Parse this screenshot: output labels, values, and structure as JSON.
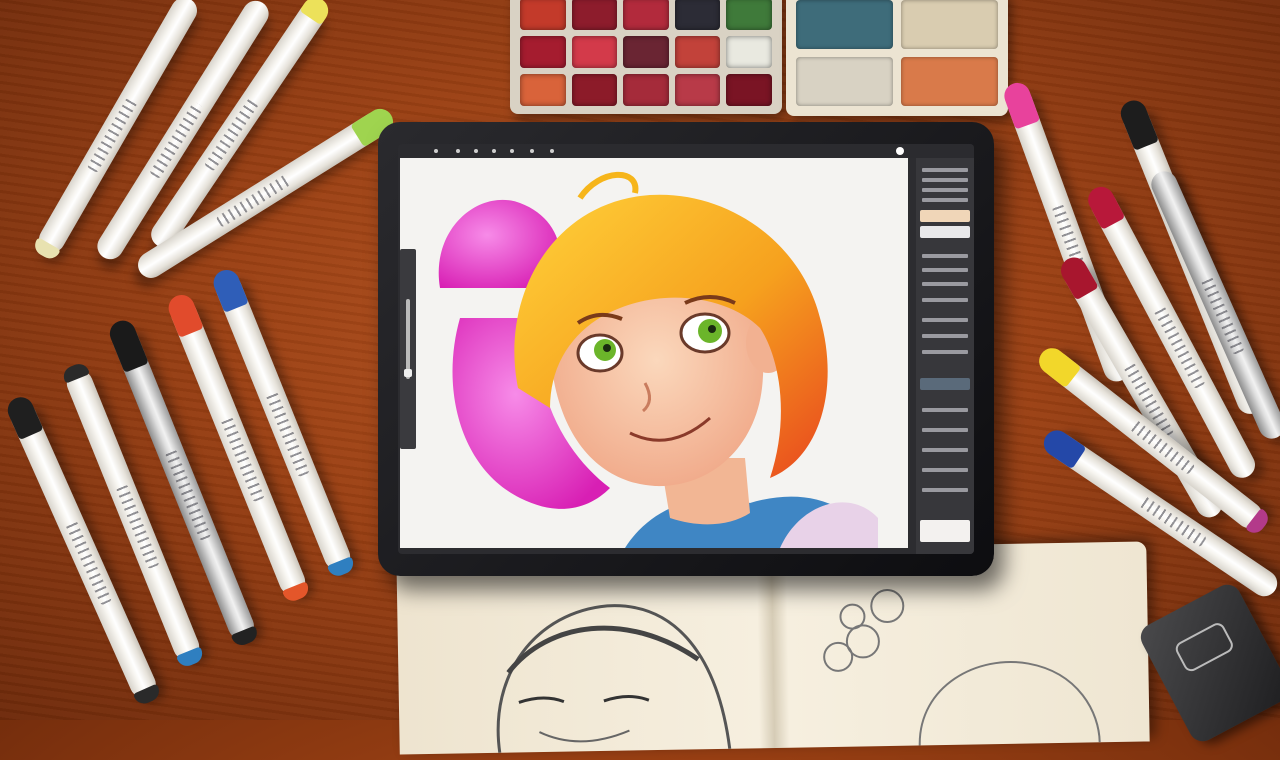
{
  "scene": "digital-drawing-desk",
  "colors": {
    "desk": "#9c4114",
    "tablet_bezel": "#151518",
    "canvas": "#f4f3f1",
    "hair_yellow": "#f6b51a",
    "hair_orange": "#e8691e",
    "hair_pink": "#e23fc0",
    "hair_magenta": "#f05be0",
    "skin": "#f7c6a4",
    "eyes": "#6bb52a",
    "shirt_blue": "#3f86c4",
    "sketch_paper": "#f2e9d6"
  },
  "marker_cap_colors": [
    "#8fd24a",
    "#1f1f1f",
    "#e84a1f",
    "#2a5fc4",
    "#e8f13a",
    "#e23a9a",
    "#b31a3a",
    "#eeeeee"
  ],
  "paint_pans": [
    "#c33a2a",
    "#8d1c2c",
    "#b22a3c",
    "#2c2c36",
    "#3f7a3a",
    "#a51c2f",
    "#d33a4a",
    "#6a2533",
    "#c2423a",
    "#e9e9e0",
    "#d9633a",
    "#8c1b29",
    "#a52b3a",
    "#b83a48",
    "#7a1424"
  ],
  "wells": [
    "#3e6c7a",
    "#d9ccb0",
    "#d8d2c3",
    "#d97a4a"
  ],
  "icons": [
    "brush-icon",
    "eraser-icon",
    "layers-icon",
    "undo-icon"
  ]
}
